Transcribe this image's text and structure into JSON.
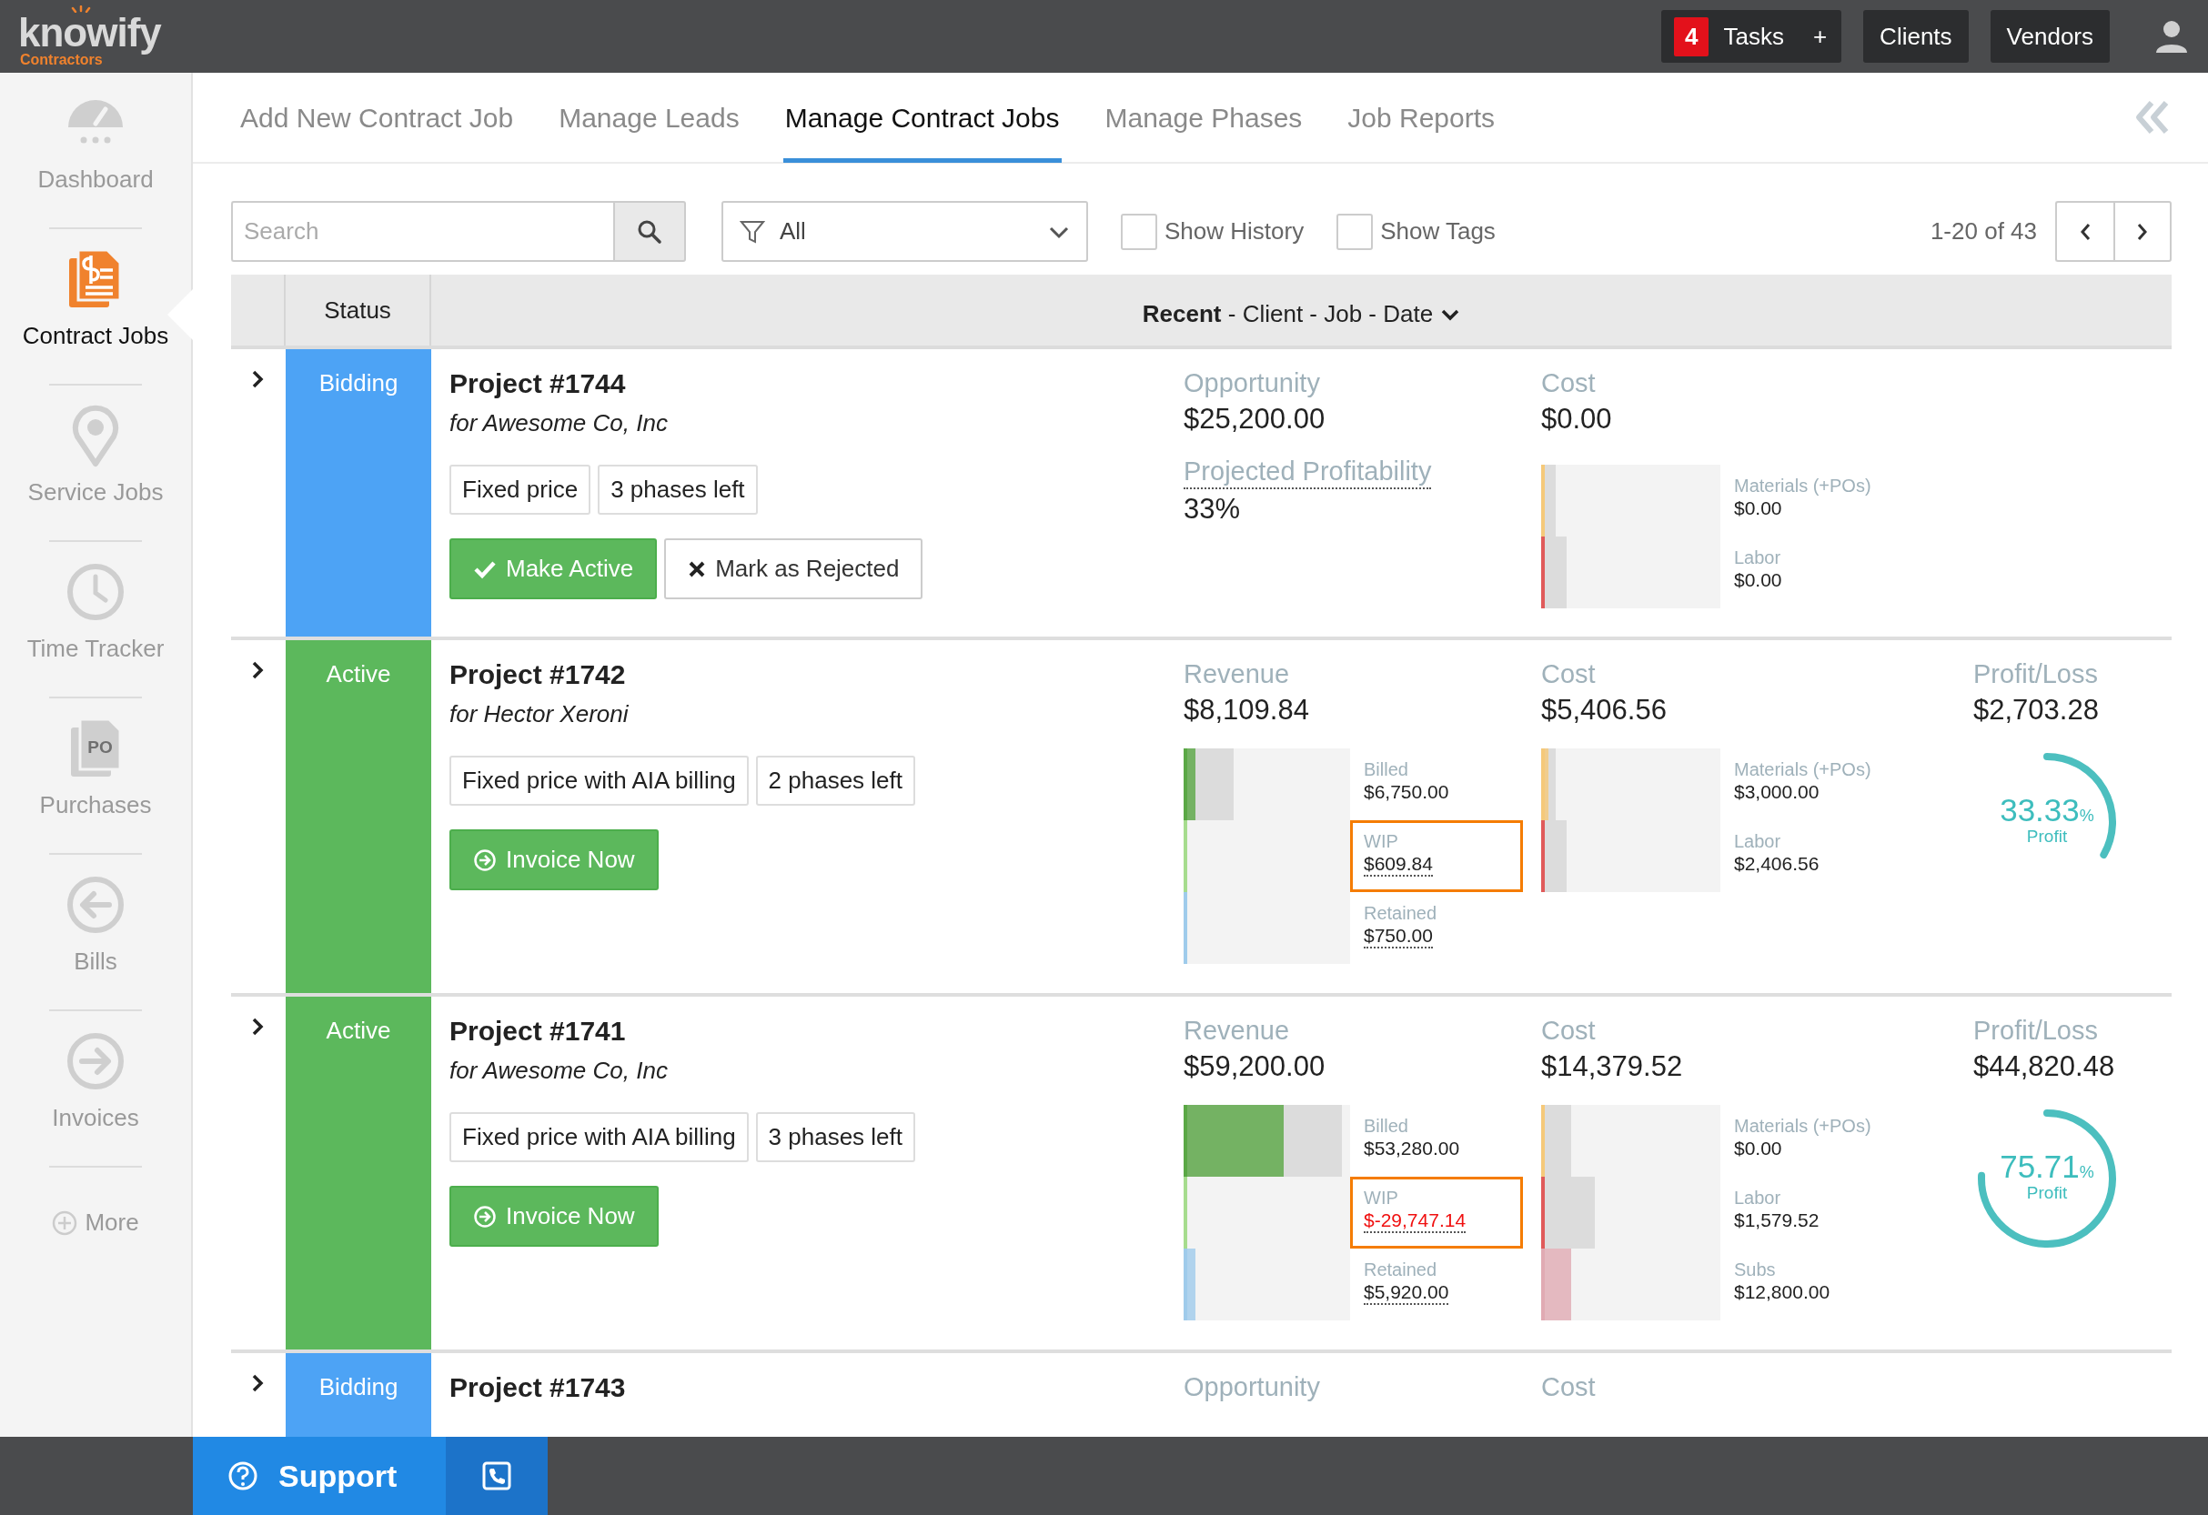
{
  "topbar": {
    "logo": "knowify",
    "logo_sub": "Contractors",
    "tasks": {
      "count": "4",
      "label": "Tasks",
      "add": "+"
    },
    "buttons": [
      "Clients",
      "Vendors"
    ]
  },
  "sidebar": {
    "items": [
      {
        "label": "Dashboard",
        "selected": false
      },
      {
        "label": "Contract Jobs",
        "selected": true
      },
      {
        "label": "Service Jobs",
        "selected": false
      },
      {
        "label": "Time Tracker",
        "selected": false
      },
      {
        "label": "Purchases",
        "selected": false,
        "icon_text": "PO"
      },
      {
        "label": "Bills",
        "selected": false
      },
      {
        "label": "Invoices",
        "selected": false
      }
    ],
    "more": "More"
  },
  "tabs": [
    {
      "label": "Add New Contract Job",
      "selected": false
    },
    {
      "label": "Manage Leads",
      "selected": false
    },
    {
      "label": "Manage Contract Jobs",
      "selected": true
    },
    {
      "label": "Manage Phases",
      "selected": false
    },
    {
      "label": "Job Reports",
      "selected": false
    }
  ],
  "toolbar": {
    "search": {
      "placeholder": "Search"
    },
    "filter": {
      "value": "All"
    },
    "checkboxes": [
      {
        "label": "Show History",
        "checked": false
      },
      {
        "label": "Show Tags",
        "checked": false
      }
    ],
    "range": "1-20 of 43"
  },
  "list": {
    "header": {
      "status": "Status",
      "sort": "**Recent** - Client - Job - Date"
    },
    "rows": [
      {
        "kind": "bidding",
        "expanded": false,
        "status": "Bidding",
        "color": "#4da3f5",
        "title": "Project #1744",
        "client": "for Awesome Co, Inc",
        "tags": [
          "Fixed price",
          "3 phases left"
        ],
        "actions": [
          {
            "kind": "confirm",
            "label": "Make Active"
          },
          {
            "kind": "reject",
            "label": "Mark as Rejected"
          }
        ],
        "revenue": {
          "label": "Opportunity",
          "amount": "$25,200.00",
          "profitability": {
            "label": "Projected Profitability",
            "value": "33%"
          }
        },
        "cost": {
          "label": "Cost",
          "amount": "$0.00",
          "segments": [
            {
              "label": "Materials (+POs)",
              "amount": "$0.00",
              "color": "#f5c97a",
              "extent": {
                "level": 0.08
              }
            },
            {
              "label": "Labor",
              "amount": "$0.00",
              "color": "#e05a5a",
              "extent": {
                "level": 0.14
              }
            }
          ]
        }
      },
      {
        "kind": "active",
        "expanded": false,
        "status": "Active",
        "color": "#5cb85c",
        "title": "Project #1742",
        "client": "for Hector Xeroni",
        "tags": [
          "Fixed price with AIA billing",
          "2 phases left"
        ],
        "actions": [
          {
            "kind": "invoice",
            "label": "Invoice Now"
          }
        ],
        "revenue": {
          "label": "Revenue",
          "amount": "$8,109.84",
          "segments": [
            {
              "label": "Billed",
              "amount": "$6,750.00",
              "color": "#5aa845",
              "fill": {
                "level": 0.07
              },
              "extent": {
                "level": 0.3
              },
              "highlighted": false,
              "negative": false,
              "dotted": false
            },
            {
              "label": "WIP",
              "amount": "$609.84",
              "color": "#a6dc8e",
              "highlighted": true,
              "negative": false,
              "dotted": true
            },
            {
              "label": "Retained",
              "amount": "$750.00",
              "color": "#9fcbeb",
              "highlighted": false,
              "negative": false,
              "dotted": true
            }
          ]
        },
        "cost": {
          "label": "Cost",
          "amount": "$5,406.56",
          "segments": [
            {
              "label": "Materials (+POs)",
              "amount": "$3,000.00",
              "color": "#f5c97a",
              "fill": {
                "level": 0.04
              },
              "extent": {
                "level": 0.08
              }
            },
            {
              "label": "Labor",
              "amount": "$2,406.56",
              "color": "#e05a5a",
              "extent": {
                "level": 0.14
              }
            }
          ]
        },
        "profit": {
          "label": "Profit/Loss",
          "amount": "$2,703.28",
          "percent": "33.33",
          "unit": "%",
          "caption": "Profit"
        }
      },
      {
        "kind": "active",
        "expanded": false,
        "status": "Active",
        "color": "#5cb85c",
        "title": "Project #1741",
        "client": "for Awesome Co, Inc",
        "tags": [
          "Fixed price with AIA billing",
          "3 phases left"
        ],
        "actions": [
          {
            "kind": "invoice",
            "label": "Invoice Now"
          }
        ],
        "revenue": {
          "label": "Revenue",
          "amount": "$59,200.00",
          "segments": [
            {
              "label": "Billed",
              "amount": "$53,280.00",
              "color": "#5aa845",
              "fill": {
                "level": 0.6
              },
              "extent": {
                "level": 0.95
              },
              "highlighted": false,
              "negative": false,
              "dotted": false
            },
            {
              "label": "WIP",
              "amount": "$-29,747.14",
              "color": "#a6dc8e",
              "highlighted": true,
              "negative": true,
              "dotted": true
            },
            {
              "label": "Retained",
              "amount": "$5,920.00",
              "color": "#9fcbeb",
              "fill": {
                "level": 0.07
              },
              "highlighted": false,
              "negative": false,
              "dotted": true
            }
          ]
        },
        "cost": {
          "label": "Cost",
          "amount": "$14,379.52",
          "segments": [
            {
              "label": "Materials (+POs)",
              "amount": "$0.00",
              "color": "#f5c97a",
              "extent": {
                "level": 0.17
              }
            },
            {
              "label": "Labor",
              "amount": "$1,579.52",
              "color": "#e05a5a",
              "extent": {
                "level": 0.3
              }
            },
            {
              "label": "Subs",
              "amount": "$12,800.00",
              "color": "#e0aab3",
              "fill": {
                "level": 0.17
              }
            }
          ]
        },
        "profit": {
          "label": "Profit/Loss",
          "amount": "$44,820.48",
          "percent": "75.71",
          "unit": "%",
          "caption": "Profit"
        }
      },
      {
        "kind": "bidding",
        "expanded": false,
        "status": "Bidding",
        "color": "#4da3f5",
        "title": "Project #1743",
        "revenue": {
          "label": "Opportunity"
        },
        "cost": {
          "label": "Cost"
        }
      }
    ]
  },
  "footer": {
    "support": "Support"
  }
}
